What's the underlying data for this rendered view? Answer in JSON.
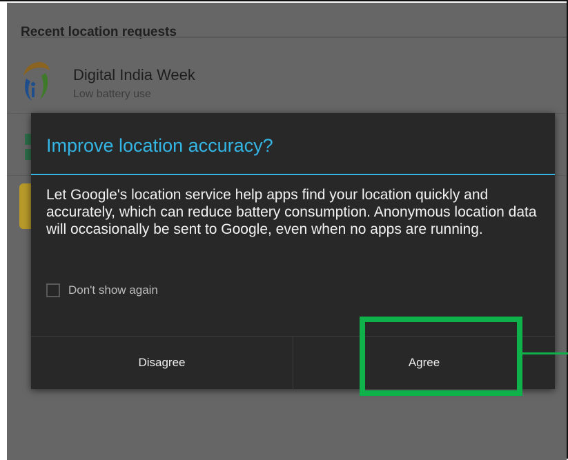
{
  "list": {
    "section_header": "Recent location requests",
    "items": [
      {
        "title": "Digital India Week",
        "subtitle": "Low battery use",
        "icon": "digital-india-logo"
      }
    ]
  },
  "dialog": {
    "title": "Improve location accuracy?",
    "message": "Let Google's location service help apps find your location quickly and accurately, which can reduce battery consumption. Anonymous location data will occasionally be sent to Google, even when no apps are running.",
    "dont_show_label": "Don't show again",
    "dont_show_checked": false,
    "buttons": {
      "disagree": "Disagree",
      "agree": "Agree"
    }
  },
  "colors": {
    "accent": "#33b5e5",
    "dialog_bg": "#282828",
    "highlight": "#0fb14a"
  }
}
